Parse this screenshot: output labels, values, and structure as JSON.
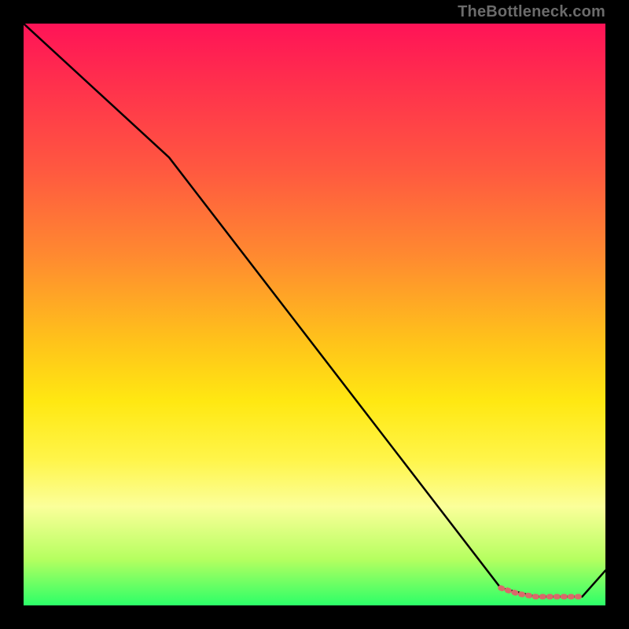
{
  "watermark": "TheBottleneck.com",
  "gradient_colors": {
    "top": "#ff1357",
    "mid_upper": "#ff8a30",
    "mid": "#ffe812",
    "mid_lower": "#fbff9a",
    "bottom": "#2cff68"
  },
  "chart_data": {
    "type": "line",
    "title": "",
    "xlabel": "",
    "ylabel": "",
    "xlim": [
      0,
      100
    ],
    "ylim": [
      0,
      100
    ],
    "grid": false,
    "series": [
      {
        "name": "black-curve",
        "color": "#000000",
        "x": [
          0,
          25,
          82,
          88,
          96,
          100
        ],
        "values": [
          100,
          77,
          3,
          1.5,
          1.5,
          6
        ]
      },
      {
        "name": "red-marker-band",
        "color": "#d96a6a",
        "x": [
          82,
          85,
          88,
          91,
          94,
          96
        ],
        "values": [
          3,
          2,
          1.5,
          1.5,
          1.5,
          1.5
        ]
      }
    ],
    "annotations": []
  }
}
